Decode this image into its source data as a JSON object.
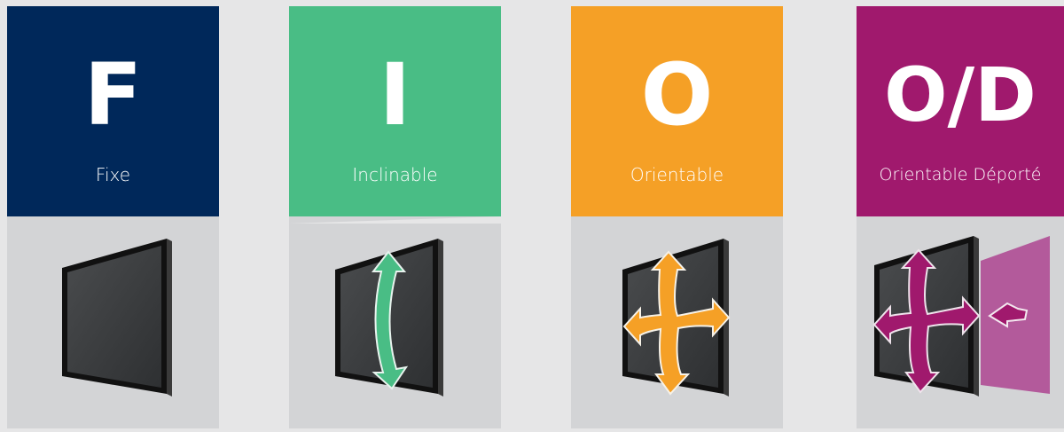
{
  "cards": [
    {
      "letter": "F",
      "label": "Fixe",
      "color": "#00285a",
      "icon": "fixed-monitor-icon"
    },
    {
      "letter": "I",
      "label": "Inclinable",
      "color": "#49bd85",
      "icon": "tilt-arrow-icon"
    },
    {
      "letter": "O",
      "label": "Orientable",
      "color": "#f5a026",
      "icon": "swivel-arrows-icon"
    },
    {
      "letter": "O/D",
      "label": "Orientable Déporté",
      "color": "#a0196d",
      "icon": "swivel-extend-arrows-icon"
    }
  ],
  "colors": {
    "panel_background": "#d3d4d6",
    "page_background": "#e6e6e7",
    "screen_frame": "#1c1c1c",
    "screen_face": "#3d3f41",
    "wall_panel": "#b35a9b"
  }
}
